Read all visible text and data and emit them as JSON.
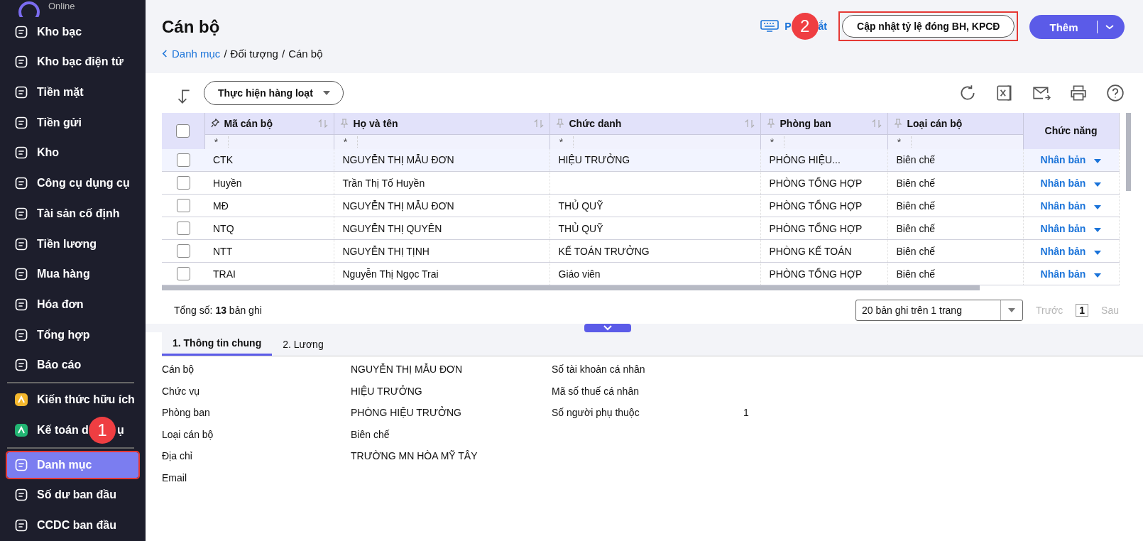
{
  "sidebar": {
    "brand_text": "Online",
    "items": [
      {
        "label": "Kho bạc",
        "kind": "normal",
        "selected": false
      },
      {
        "label": "Kho bạc điện tử",
        "kind": "normal",
        "selected": false
      },
      {
        "label": "Tiền mặt",
        "kind": "normal",
        "selected": false
      },
      {
        "label": "Tiền gửi",
        "kind": "normal",
        "selected": false
      },
      {
        "label": "Kho",
        "kind": "normal",
        "selected": false
      },
      {
        "label": "Công cụ dụng cụ",
        "kind": "normal",
        "selected": false
      },
      {
        "label": "Tài sản cố định",
        "kind": "normal",
        "selected": false
      },
      {
        "label": "Tiền lương",
        "kind": "normal",
        "selected": false
      },
      {
        "label": "Mua hàng",
        "kind": "normal",
        "selected": false
      },
      {
        "label": "Hóa đơn",
        "kind": "normal",
        "selected": false
      },
      {
        "label": "Tổng hợp",
        "kind": "normal",
        "selected": false
      },
      {
        "label": "Báo cáo",
        "kind": "normal",
        "selected": false
      },
      {
        "label": "Kiến thức hữu ích",
        "kind": "featured",
        "color": "#f5b82e",
        "selected": false
      },
      {
        "label": "Kế toán d",
        "label_after": "ụ",
        "kind": "featured",
        "color": "#22b573",
        "selected": false,
        "badge": "1"
      },
      {
        "label": "Danh mục",
        "kind": "normal",
        "selected": true,
        "highlighted": true
      },
      {
        "label": "Số dư ban đầu",
        "kind": "normal",
        "selected": false
      },
      {
        "label": "CCDC ban đầu",
        "kind": "normal",
        "selected": false
      }
    ]
  },
  "header": {
    "title": "Cán bộ",
    "breadcrumb": [
      {
        "label": "Danh mục",
        "link": true
      },
      {
        "label": "Đối tượng",
        "link": false
      },
      {
        "label": "Cán bộ",
        "link": false
      }
    ],
    "separator": "/",
    "shortcut": {
      "label": "P",
      "label_after": "ắt",
      "badge": "2"
    },
    "update_button": {
      "label": "Cập nhật tỷ lệ đóng BH, KPCĐ",
      "highlighted": true
    },
    "add_button": {
      "label": "Thêm"
    }
  },
  "toolbar": {
    "batch_button": "Thực hiện hàng loạt"
  },
  "table": {
    "columns": [
      {
        "label": "Mã cán bộ",
        "pinned": true,
        "sortable": true,
        "filter": "*"
      },
      {
        "label": "Họ và tên",
        "pinned": false,
        "sortable": true,
        "filter": "*"
      },
      {
        "label": "Chức danh",
        "pinned": false,
        "sortable": true,
        "filter": "*"
      },
      {
        "label": "Phòng ban",
        "pinned": false,
        "sortable": true,
        "filter": "*"
      },
      {
        "label": "Loại cán bộ",
        "pinned": false,
        "sortable": false,
        "filter": "*"
      },
      {
        "label": "Chức năng"
      }
    ],
    "select_all_checked": false,
    "rows": [
      {
        "selected": true,
        "checked": false,
        "cells": [
          "CTK",
          "NGUYỄN THỊ MẪU ĐƠN",
          "HIỆU TRƯỞNG",
          "PHÒNG HIỆU...",
          "Biên chế"
        ],
        "action": "Nhân bản"
      },
      {
        "selected": false,
        "checked": false,
        "cells": [
          "Huyền",
          "Trần Thị Tố Huyền",
          "",
          "PHÒNG TỔNG HỢP",
          "Biên chế"
        ],
        "action": "Nhân bản"
      },
      {
        "selected": false,
        "checked": false,
        "cells": [
          "MĐ",
          "NGUYỄN THỊ MẪU ĐƠN",
          "THỦ QUỸ",
          "PHÒNG TỔNG HỢP",
          "Biên chế"
        ],
        "action": "Nhân bản"
      },
      {
        "selected": false,
        "checked": false,
        "cells": [
          "NTQ",
          "NGUYỄN THỊ QUYÊN",
          "THỦ QUỸ",
          "PHÒNG TỔNG HỢP",
          "Biên chế"
        ],
        "action": "Nhân bản"
      },
      {
        "selected": false,
        "checked": false,
        "cells": [
          "NTT",
          "NGUYỄN THỊ TỊNH",
          "KẾ TOÁN TRƯỞNG",
          "PHÒNG KẾ TOÁN",
          "Biên chế"
        ],
        "action": "Nhân bản"
      },
      {
        "selected": false,
        "checked": false,
        "cells": [
          "TRAI",
          "Nguyễn Thị Ngọc Trai",
          "Giáo viên",
          "PHÒNG TỔNG HỢP",
          "Biên chế"
        ],
        "action": "Nhân bản"
      }
    ],
    "total": "Tổng số: **13** bản ghi",
    "page_size": "20 bản ghi trên 1 trang",
    "prev": "Trước",
    "page": "1",
    "next": "Sau"
  },
  "detail": {
    "tabs": [
      {
        "label": "1. Thông tin chung",
        "selected": true
      },
      {
        "label": "2. Lương",
        "selected": false
      }
    ],
    "left_fields": [
      {
        "label": "Cán bộ",
        "value": "NGUYỄN THỊ MẪU ĐƠN"
      },
      {
        "label": "Chức vụ",
        "value": "HIỆU TRƯỞNG"
      },
      {
        "label": "Phòng ban",
        "value": "PHÒNG HIỆU TRƯỞNG"
      },
      {
        "label": "Loại cán bộ",
        "value": "Biên chế"
      },
      {
        "label": "Địa chỉ",
        "value": "TRƯỜNG MN HÒA MỸ TÂY"
      },
      {
        "label": "Email"
      }
    ],
    "right_fields": [
      {
        "label": "Số tài khoản cá nhân"
      },
      {
        "label": "Mã số thuế cá nhân"
      },
      {
        "label": "Số người phụ thuộc",
        "value": "1"
      }
    ]
  }
}
